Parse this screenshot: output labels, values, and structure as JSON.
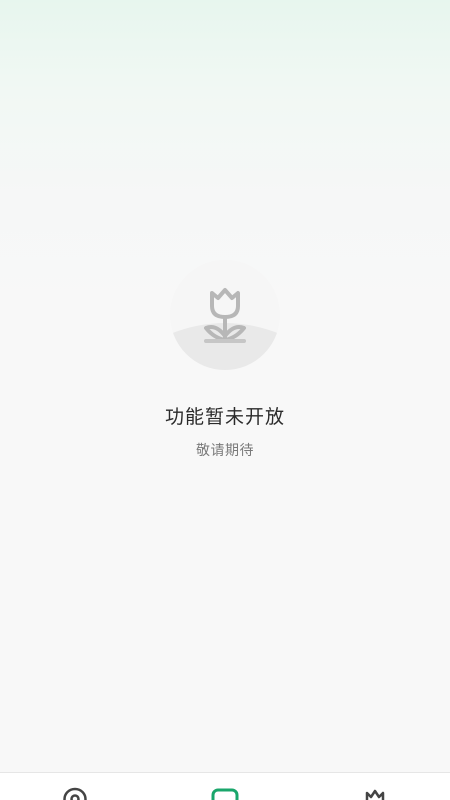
{
  "empty_state": {
    "title": "功能暂未开放",
    "subtitle": "敬请期待",
    "illustration_icon": "tulip-icon"
  },
  "tabbar": {
    "items": [
      {
        "icon": "location-pin-icon",
        "active": false
      },
      {
        "icon": "square-icon",
        "active": true
      },
      {
        "icon": "tulip-icon",
        "active": false
      }
    ],
    "active_color": "#1aa66b",
    "inactive_color": "#444444"
  }
}
